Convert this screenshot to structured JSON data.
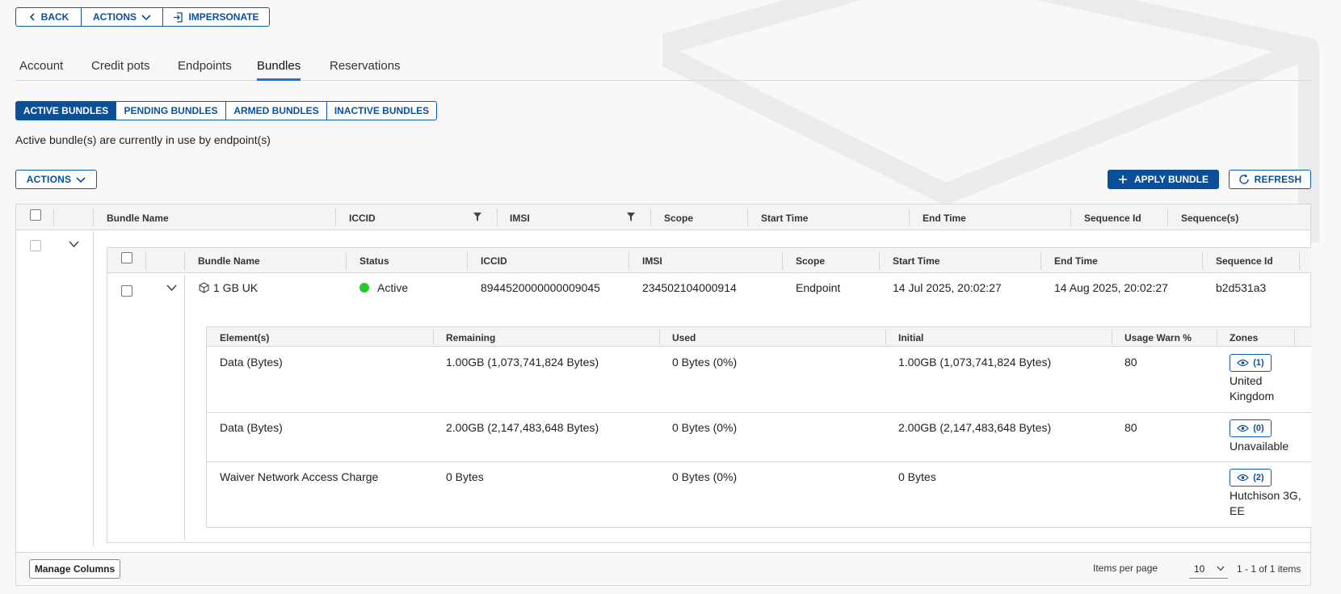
{
  "toolbar": {
    "back": "BACK",
    "actions": "ACTIONS",
    "impersonate": "IMPERSONATE"
  },
  "tabs": [
    "Account",
    "Credit pots",
    "Endpoints",
    "Bundles",
    "Reservations"
  ],
  "active_tab": "Bundles",
  "bundle_filters": [
    "ACTIVE BUNDLES",
    "PENDING BUNDLES",
    "ARMED BUNDLES",
    "INACTIVE BUNDLES"
  ],
  "description": "Active bundle(s) are currently in use by endpoint(s)",
  "list_toolbar": {
    "actions": "ACTIONS",
    "apply_bundle": "APPLY BUNDLE",
    "refresh": "REFRESH"
  },
  "outer_headers": [
    "Bundle Name",
    "ICCID",
    "IMSI",
    "Scope",
    "Start Time",
    "End Time",
    "Sequence Id",
    "Sequence(s)"
  ],
  "inner_headers": [
    "Bundle Name",
    "Status",
    "ICCID",
    "IMSI",
    "Scope",
    "Start Time",
    "End Time",
    "Sequence Id"
  ],
  "bundle_row": {
    "name": "1 GB UK",
    "status": "Active",
    "status_color": "#22cc22",
    "iccid": "8944520000000009045",
    "imsi": "234502104000914",
    "scope": "Endpoint",
    "start": "14 Jul 2025, 20:02:27",
    "end": "14 Aug 2025, 20:02:27",
    "sequence_id": "b2d531a3"
  },
  "element_headers": [
    "Element(s)",
    "Remaining",
    "Used",
    "Initial",
    "Usage Warn %",
    "Zones"
  ],
  "elements": [
    {
      "element": "Data (Bytes)",
      "remaining": "1.00GB (1,073,741,824 Bytes)",
      "used": "0 Bytes (0%)",
      "initial": "1.00GB (1,073,741,824 Bytes)",
      "warn": "80",
      "zone_count": "(1)",
      "zone_name": "United Kingdom"
    },
    {
      "element": "Data (Bytes)",
      "remaining": "2.00GB (2,147,483,648 Bytes)",
      "used": "0 Bytes (0%)",
      "initial": "2.00GB (2,147,483,648 Bytes)",
      "warn": "80",
      "zone_count": "(0)",
      "zone_name": "Unavailable"
    },
    {
      "element": "Waiver Network Access Charge",
      "remaining": "0 Bytes",
      "used": "0 Bytes (0%)",
      "initial": "0 Bytes",
      "warn": "",
      "zone_count": "(2)",
      "zone_name": "Hutchison 3G, EE"
    }
  ],
  "footer": {
    "manage_columns": "Manage Columns",
    "items_per_page_label": "Items per page",
    "items_per_page": "10",
    "range": "1 - 1 of 1 items"
  },
  "colors": {
    "primary": "#0b4f99",
    "tab_underline": "#1473e6"
  }
}
